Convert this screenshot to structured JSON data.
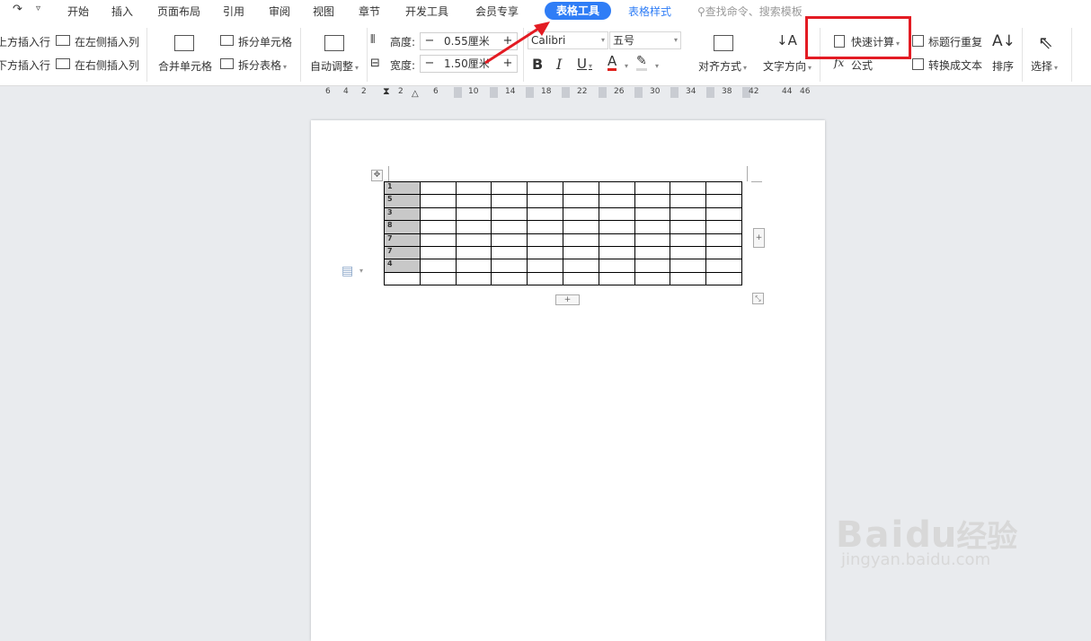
{
  "tabs": {
    "home": "开始",
    "insert": "插入",
    "layout": "页面布局",
    "reference": "引用",
    "review": "审阅",
    "view": "视图",
    "chapter": "章节",
    "developer": "开发工具",
    "member": "会员专享",
    "table_tools": "表格工具",
    "table_style": "表格样式"
  },
  "search": {
    "placeholder": "查找命令、搜索模板"
  },
  "ribbon": {
    "insert_above": "上方插入行",
    "insert_below": "下方插入行",
    "insert_left": "在左侧插入列",
    "insert_right": "在右侧插入列",
    "merge_cells": "合并单元格",
    "split_cells": "拆分单元格",
    "split_table": "拆分表格",
    "auto_fit": "自动调整",
    "height_label": "高度:",
    "height_value": "0.55厘米",
    "width_label": "宽度:",
    "width_value": "1.50厘米",
    "font_name": "Calibri",
    "font_size": "五号",
    "align": "对齐方式",
    "text_direction": "文字方向",
    "quick_calc": "快速计算",
    "formula": "公式",
    "repeat_header": "标题行重复",
    "convert_text": "转换成文本",
    "sort": "排序",
    "select": "选择",
    "bold": "B",
    "italic": "I",
    "underline": "U",
    "font_color": "A"
  },
  "ruler": [
    "6",
    "4",
    "2",
    "2",
    "6",
    "10",
    "14",
    "18",
    "22",
    "26",
    "30",
    "34",
    "38",
    "42",
    "44",
    "46"
  ],
  "table": {
    "first_column": [
      "1",
      "5",
      "3",
      "8",
      "7",
      "7",
      "4",
      ""
    ],
    "columns": 10
  },
  "watermark": {
    "brand": "Bai",
    "brand2": "du",
    "brand_cn": "经验",
    "url": "jingyan.baidu.com"
  }
}
